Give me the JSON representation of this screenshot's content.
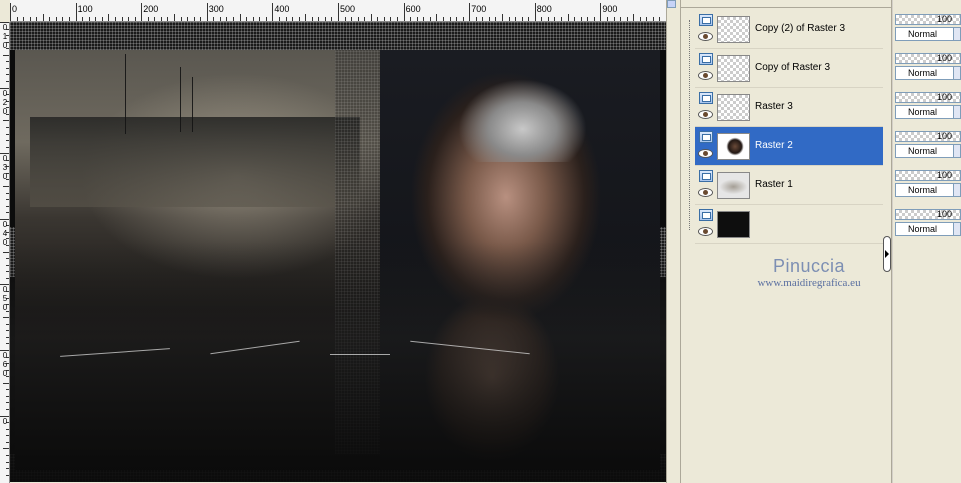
{
  "ruler": {
    "top_labels": [
      "0",
      "100",
      "200",
      "300",
      "400",
      "500",
      "600",
      "700",
      "800",
      "900"
    ],
    "left_labels": [
      "0",
      "1",
      "0",
      "0",
      "2",
      "0",
      "0",
      "3",
      "0",
      "0",
      "4",
      "0",
      "0",
      "5",
      "0",
      "0",
      "6",
      "0",
      "0"
    ]
  },
  "layers": [
    {
      "name": "Copy (2) of Raster 3",
      "thumbnail": "transparent",
      "selected": false,
      "opacity": "100",
      "blend": "Normal"
    },
    {
      "name": "Copy of Raster 3",
      "thumbnail": "transparent",
      "selected": false,
      "opacity": "100",
      "blend": "Normal"
    },
    {
      "name": "Raster 3",
      "thumbnail": "transparent",
      "selected": false,
      "opacity": "100",
      "blend": "Normal"
    },
    {
      "name": "Raster 2",
      "thumbnail": "face",
      "selected": true,
      "opacity": "100",
      "blend": "Normal"
    },
    {
      "name": "Raster 1",
      "thumbnail": "faint",
      "selected": false,
      "opacity": "100",
      "blend": "Normal"
    },
    {
      "name": "",
      "thumbnail": "dark",
      "selected": false,
      "opacity": "100",
      "blend": "Normal"
    }
  ],
  "watermark": {
    "name": "Pinuccia",
    "url": "www.maidiregrafica.eu"
  },
  "icons": {
    "layer_type": "raster-layer-icon",
    "visibility": "eye-icon",
    "expander": "chevron-right-icon"
  },
  "colors": {
    "selection": "#316ac5",
    "panel_bg": "#ece9d8",
    "watermark": "#7d8fb3"
  }
}
